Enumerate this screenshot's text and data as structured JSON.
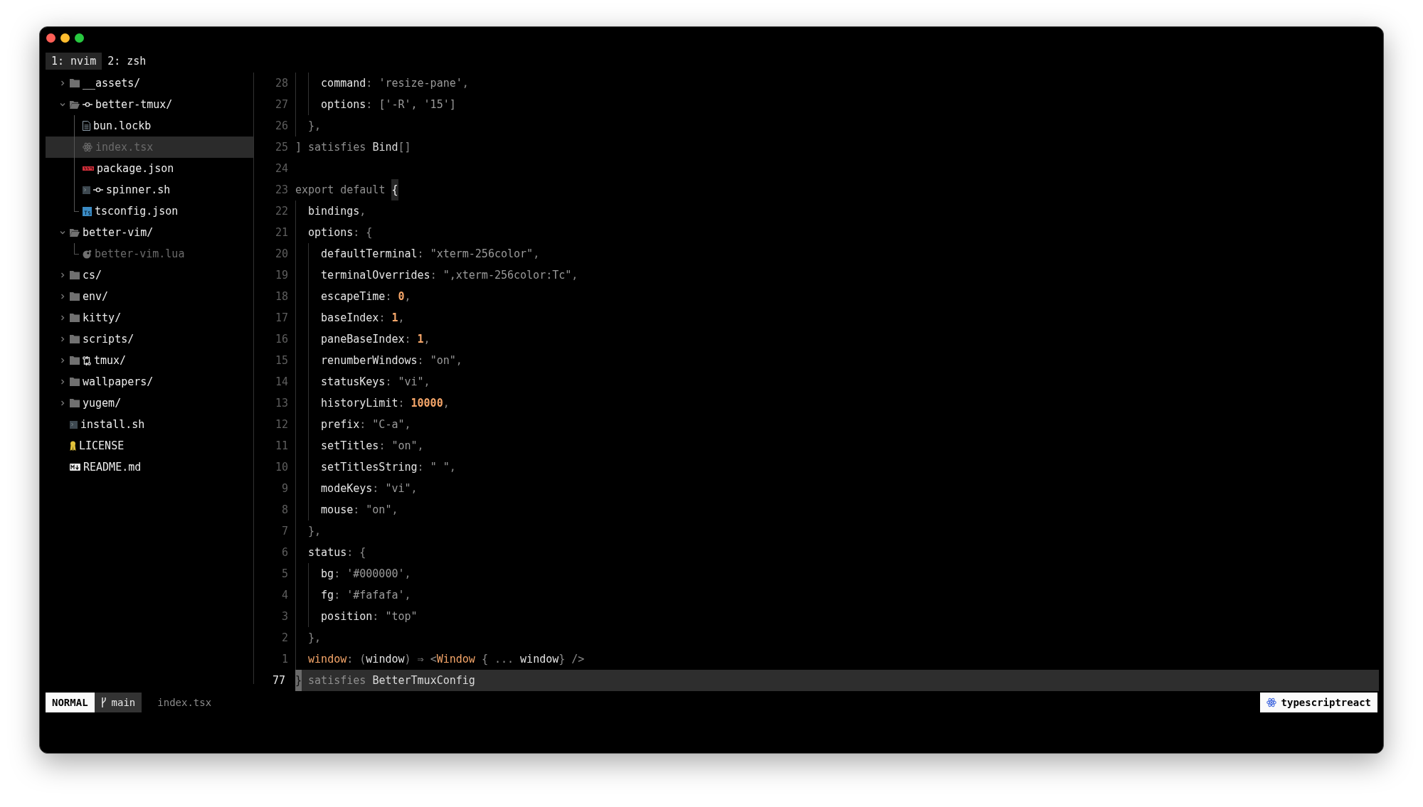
{
  "tabs": [
    {
      "label": "1: nvim",
      "selected": true
    },
    {
      "label": "2: zsh",
      "selected": false
    }
  ],
  "tree": {
    "items": [
      {
        "name": "__assets/",
        "kind": "folder",
        "expanded": false,
        "selected": false,
        "dimmed": false
      },
      {
        "name": "better-tmux/",
        "kind": "folder",
        "badge": {
          "kind": "commit"
        },
        "expanded": true,
        "selected": false,
        "dimmed": false,
        "children": [
          {
            "name": "bun.lockb",
            "kind": "document",
            "selected": false,
            "dimmed": false
          },
          {
            "name": "index.tsx",
            "kind": "react",
            "selected": true,
            "dimmed": true
          },
          {
            "name": "package.json",
            "kind": "npm",
            "selected": false,
            "dimmed": false
          },
          {
            "name": "spinner.sh",
            "kind": "shell",
            "badge": {
              "kind": "commit"
            },
            "selected": false,
            "dimmed": false
          },
          {
            "name": "tsconfig.json",
            "kind": "ts",
            "selected": false,
            "dimmed": false
          }
        ]
      },
      {
        "name": "better-vim/",
        "kind": "folder",
        "expanded": true,
        "selected": false,
        "dimmed": false,
        "children": [
          {
            "name": "better-vim.lua",
            "kind": "lua",
            "selected": false,
            "dimmed": true
          }
        ]
      },
      {
        "name": "cs/",
        "kind": "folder",
        "expanded": false,
        "selected": false,
        "dimmed": false
      },
      {
        "name": "env/",
        "kind": "folder",
        "expanded": false,
        "selected": false,
        "dimmed": false
      },
      {
        "name": "kitty/",
        "kind": "folder",
        "expanded": false,
        "selected": false,
        "dimmed": false
      },
      {
        "name": "scripts/",
        "kind": "folder",
        "expanded": false,
        "selected": false,
        "dimmed": false
      },
      {
        "name": "tmux/",
        "kind": "folder",
        "badge": {
          "kind": "compare"
        },
        "expanded": false,
        "selected": false,
        "dimmed": false
      },
      {
        "name": "wallpapers/",
        "kind": "folder",
        "expanded": false,
        "selected": false,
        "dimmed": false
      },
      {
        "name": "yugem/",
        "kind": "folder",
        "expanded": false,
        "selected": false,
        "dimmed": false
      },
      {
        "name": "install.sh",
        "kind": "shell",
        "selected": false,
        "dimmed": false
      },
      {
        "name": "LICENSE",
        "kind": "license",
        "selected": false,
        "dimmed": false
      },
      {
        "name": "README.md",
        "kind": "markdown",
        "selected": false,
        "dimmed": false
      }
    ]
  },
  "editor": {
    "lines": [
      {
        "number": "28",
        "current": false,
        "tokens": [
          {
            "kind": "key",
            "text": "    command"
          },
          {
            "kind": "punct",
            "text": ": "
          },
          {
            "kind": "str",
            "text": "'resize-pane'"
          },
          {
            "kind": "punct",
            "text": ","
          }
        ]
      },
      {
        "number": "27",
        "current": false,
        "tokens": [
          {
            "kind": "key",
            "text": "    options"
          },
          {
            "kind": "punct",
            "text": ": "
          },
          {
            "kind": "str",
            "text": "['-R', '15']"
          }
        ]
      },
      {
        "number": "26",
        "current": false,
        "tokens": [
          {
            "kind": "punct",
            "text": "  },"
          }
        ]
      },
      {
        "number": "25",
        "current": false,
        "tokens": [
          {
            "kind": "punct",
            "text": "] "
          },
          {
            "kind": "keyword",
            "text": "satisfies "
          },
          {
            "kind": "type",
            "text": "Bind"
          },
          {
            "kind": "punct",
            "text": "[]"
          }
        ]
      },
      {
        "number": "24",
        "current": false
      },
      {
        "number": "23",
        "current": false,
        "tokens": [
          {
            "kind": "keyword",
            "text": "export default "
          },
          {
            "kind": "match",
            "text": "{"
          }
        ]
      },
      {
        "number": "22",
        "current": false,
        "tokens": [
          {
            "kind": "key",
            "text": "  bindings"
          },
          {
            "kind": "punct",
            "text": ","
          }
        ]
      },
      {
        "number": "21",
        "current": false,
        "tokens": [
          {
            "kind": "key",
            "text": "  options"
          },
          {
            "kind": "punct",
            "text": ": {"
          }
        ]
      },
      {
        "number": "20",
        "current": false,
        "tokens": [
          {
            "kind": "key",
            "text": "    defaultTerminal"
          },
          {
            "kind": "punct",
            "text": ": "
          },
          {
            "kind": "str",
            "text": "\"xterm-256color\""
          },
          {
            "kind": "punct",
            "text": ","
          }
        ]
      },
      {
        "number": "19",
        "current": false,
        "tokens": [
          {
            "kind": "key",
            "text": "    terminalOverrides"
          },
          {
            "kind": "punct",
            "text": ": "
          },
          {
            "kind": "str",
            "text": "\",xterm-256color:Tc\""
          },
          {
            "kind": "punct",
            "text": ","
          }
        ]
      },
      {
        "number": "18",
        "current": false,
        "tokens": [
          {
            "kind": "key",
            "text": "    escapeTime"
          },
          {
            "kind": "punct",
            "text": ": "
          },
          {
            "kind": "num",
            "text": "0"
          },
          {
            "kind": "punct",
            "text": ","
          }
        ]
      },
      {
        "number": "17",
        "current": false,
        "tokens": [
          {
            "kind": "key",
            "text": "    baseIndex"
          },
          {
            "kind": "punct",
            "text": ": "
          },
          {
            "kind": "num",
            "text": "1"
          },
          {
            "kind": "punct",
            "text": ","
          }
        ]
      },
      {
        "number": "16",
        "current": false,
        "tokens": [
          {
            "kind": "key",
            "text": "    paneBaseIndex"
          },
          {
            "kind": "punct",
            "text": ": "
          },
          {
            "kind": "num",
            "text": "1"
          },
          {
            "kind": "punct",
            "text": ","
          }
        ]
      },
      {
        "number": "15",
        "current": false,
        "tokens": [
          {
            "kind": "key",
            "text": "    renumberWindows"
          },
          {
            "kind": "punct",
            "text": ": "
          },
          {
            "kind": "str",
            "text": "\"on\""
          },
          {
            "kind": "punct",
            "text": ","
          }
        ]
      },
      {
        "number": "14",
        "current": false,
        "tokens": [
          {
            "kind": "key",
            "text": "    statusKeys"
          },
          {
            "kind": "punct",
            "text": ": "
          },
          {
            "kind": "str",
            "text": "\"vi\""
          },
          {
            "kind": "punct",
            "text": ","
          }
        ]
      },
      {
        "number": "13",
        "current": false,
        "tokens": [
          {
            "kind": "key",
            "text": "    historyLimit"
          },
          {
            "kind": "punct",
            "text": ": "
          },
          {
            "kind": "num",
            "text": "10000"
          },
          {
            "kind": "punct",
            "text": ","
          }
        ]
      },
      {
        "number": "12",
        "current": false,
        "tokens": [
          {
            "kind": "key",
            "text": "    prefix"
          },
          {
            "kind": "punct",
            "text": ": "
          },
          {
            "kind": "str",
            "text": "\"C-a\""
          },
          {
            "kind": "punct",
            "text": ","
          }
        ]
      },
      {
        "number": "11",
        "current": false,
        "tokens": [
          {
            "kind": "key",
            "text": "    setTitles"
          },
          {
            "kind": "punct",
            "text": ": "
          },
          {
            "kind": "str",
            "text": "\"on\""
          },
          {
            "kind": "punct",
            "text": ","
          }
        ]
      },
      {
        "number": "10",
        "current": false,
        "tokens": [
          {
            "kind": "key",
            "text": "    setTitlesString"
          },
          {
            "kind": "punct",
            "text": ": "
          },
          {
            "kind": "str",
            "text": "\" \""
          },
          {
            "kind": "punct",
            "text": ","
          }
        ]
      },
      {
        "number": "9",
        "current": false,
        "tokens": [
          {
            "kind": "key",
            "text": "    modeKeys"
          },
          {
            "kind": "punct",
            "text": ": "
          },
          {
            "kind": "str",
            "text": "\"vi\""
          },
          {
            "kind": "punct",
            "text": ","
          }
        ]
      },
      {
        "number": "8",
        "current": false,
        "tokens": [
          {
            "kind": "key",
            "text": "    mouse"
          },
          {
            "kind": "punct",
            "text": ": "
          },
          {
            "kind": "str",
            "text": "\"on\""
          },
          {
            "kind": "punct",
            "text": ","
          }
        ]
      },
      {
        "number": "7",
        "current": false,
        "tokens": [
          {
            "kind": "punct",
            "text": "  },"
          }
        ]
      },
      {
        "number": "6",
        "current": false,
        "tokens": [
          {
            "kind": "key",
            "text": "  status"
          },
          {
            "kind": "punct",
            "text": ": {"
          }
        ]
      },
      {
        "number": "5",
        "current": false,
        "tokens": [
          {
            "kind": "key",
            "text": "    bg"
          },
          {
            "kind": "punct",
            "text": ": "
          },
          {
            "kind": "str",
            "text": "'#000000'"
          },
          {
            "kind": "punct",
            "text": ","
          }
        ]
      },
      {
        "number": "4",
        "current": false,
        "tokens": [
          {
            "kind": "key",
            "text": "    fg"
          },
          {
            "kind": "punct",
            "text": ": "
          },
          {
            "kind": "str",
            "text": "'#fafafa'"
          },
          {
            "kind": "punct",
            "text": ","
          }
        ]
      },
      {
        "number": "3",
        "current": false,
        "tokens": [
          {
            "kind": "key",
            "text": "    position"
          },
          {
            "kind": "punct",
            "text": ": "
          },
          {
            "kind": "str",
            "text": "\"top\""
          }
        ]
      },
      {
        "number": "2",
        "current": false,
        "tokens": [
          {
            "kind": "punct",
            "text": "  },"
          }
        ]
      },
      {
        "number": "1",
        "current": false,
        "tokens": [
          {
            "kind": "tag",
            "text": "  window"
          },
          {
            "kind": "punct",
            "text": ": ("
          },
          {
            "kind": "key",
            "text": "window"
          },
          {
            "kind": "punct",
            "text": ") ⇒ <"
          },
          {
            "kind": "tag",
            "text": "Window"
          },
          {
            "kind": "punct",
            "text": " { ... "
          },
          {
            "kind": "key",
            "text": "window"
          },
          {
            "kind": "punct",
            "text": "} />"
          }
        ]
      },
      {
        "number": "77",
        "current": true,
        "tokens": [
          {
            "kind": "cursor",
            "text": "}"
          },
          {
            "kind": "keyword",
            "text": " satisfies "
          },
          {
            "kind": "type",
            "text": "BetterTmuxConfig"
          }
        ]
      }
    ]
  },
  "status_line": {
    "mode": "NORMAL",
    "branch": "main",
    "file": "index.tsx",
    "filetype": "typescriptreact"
  }
}
